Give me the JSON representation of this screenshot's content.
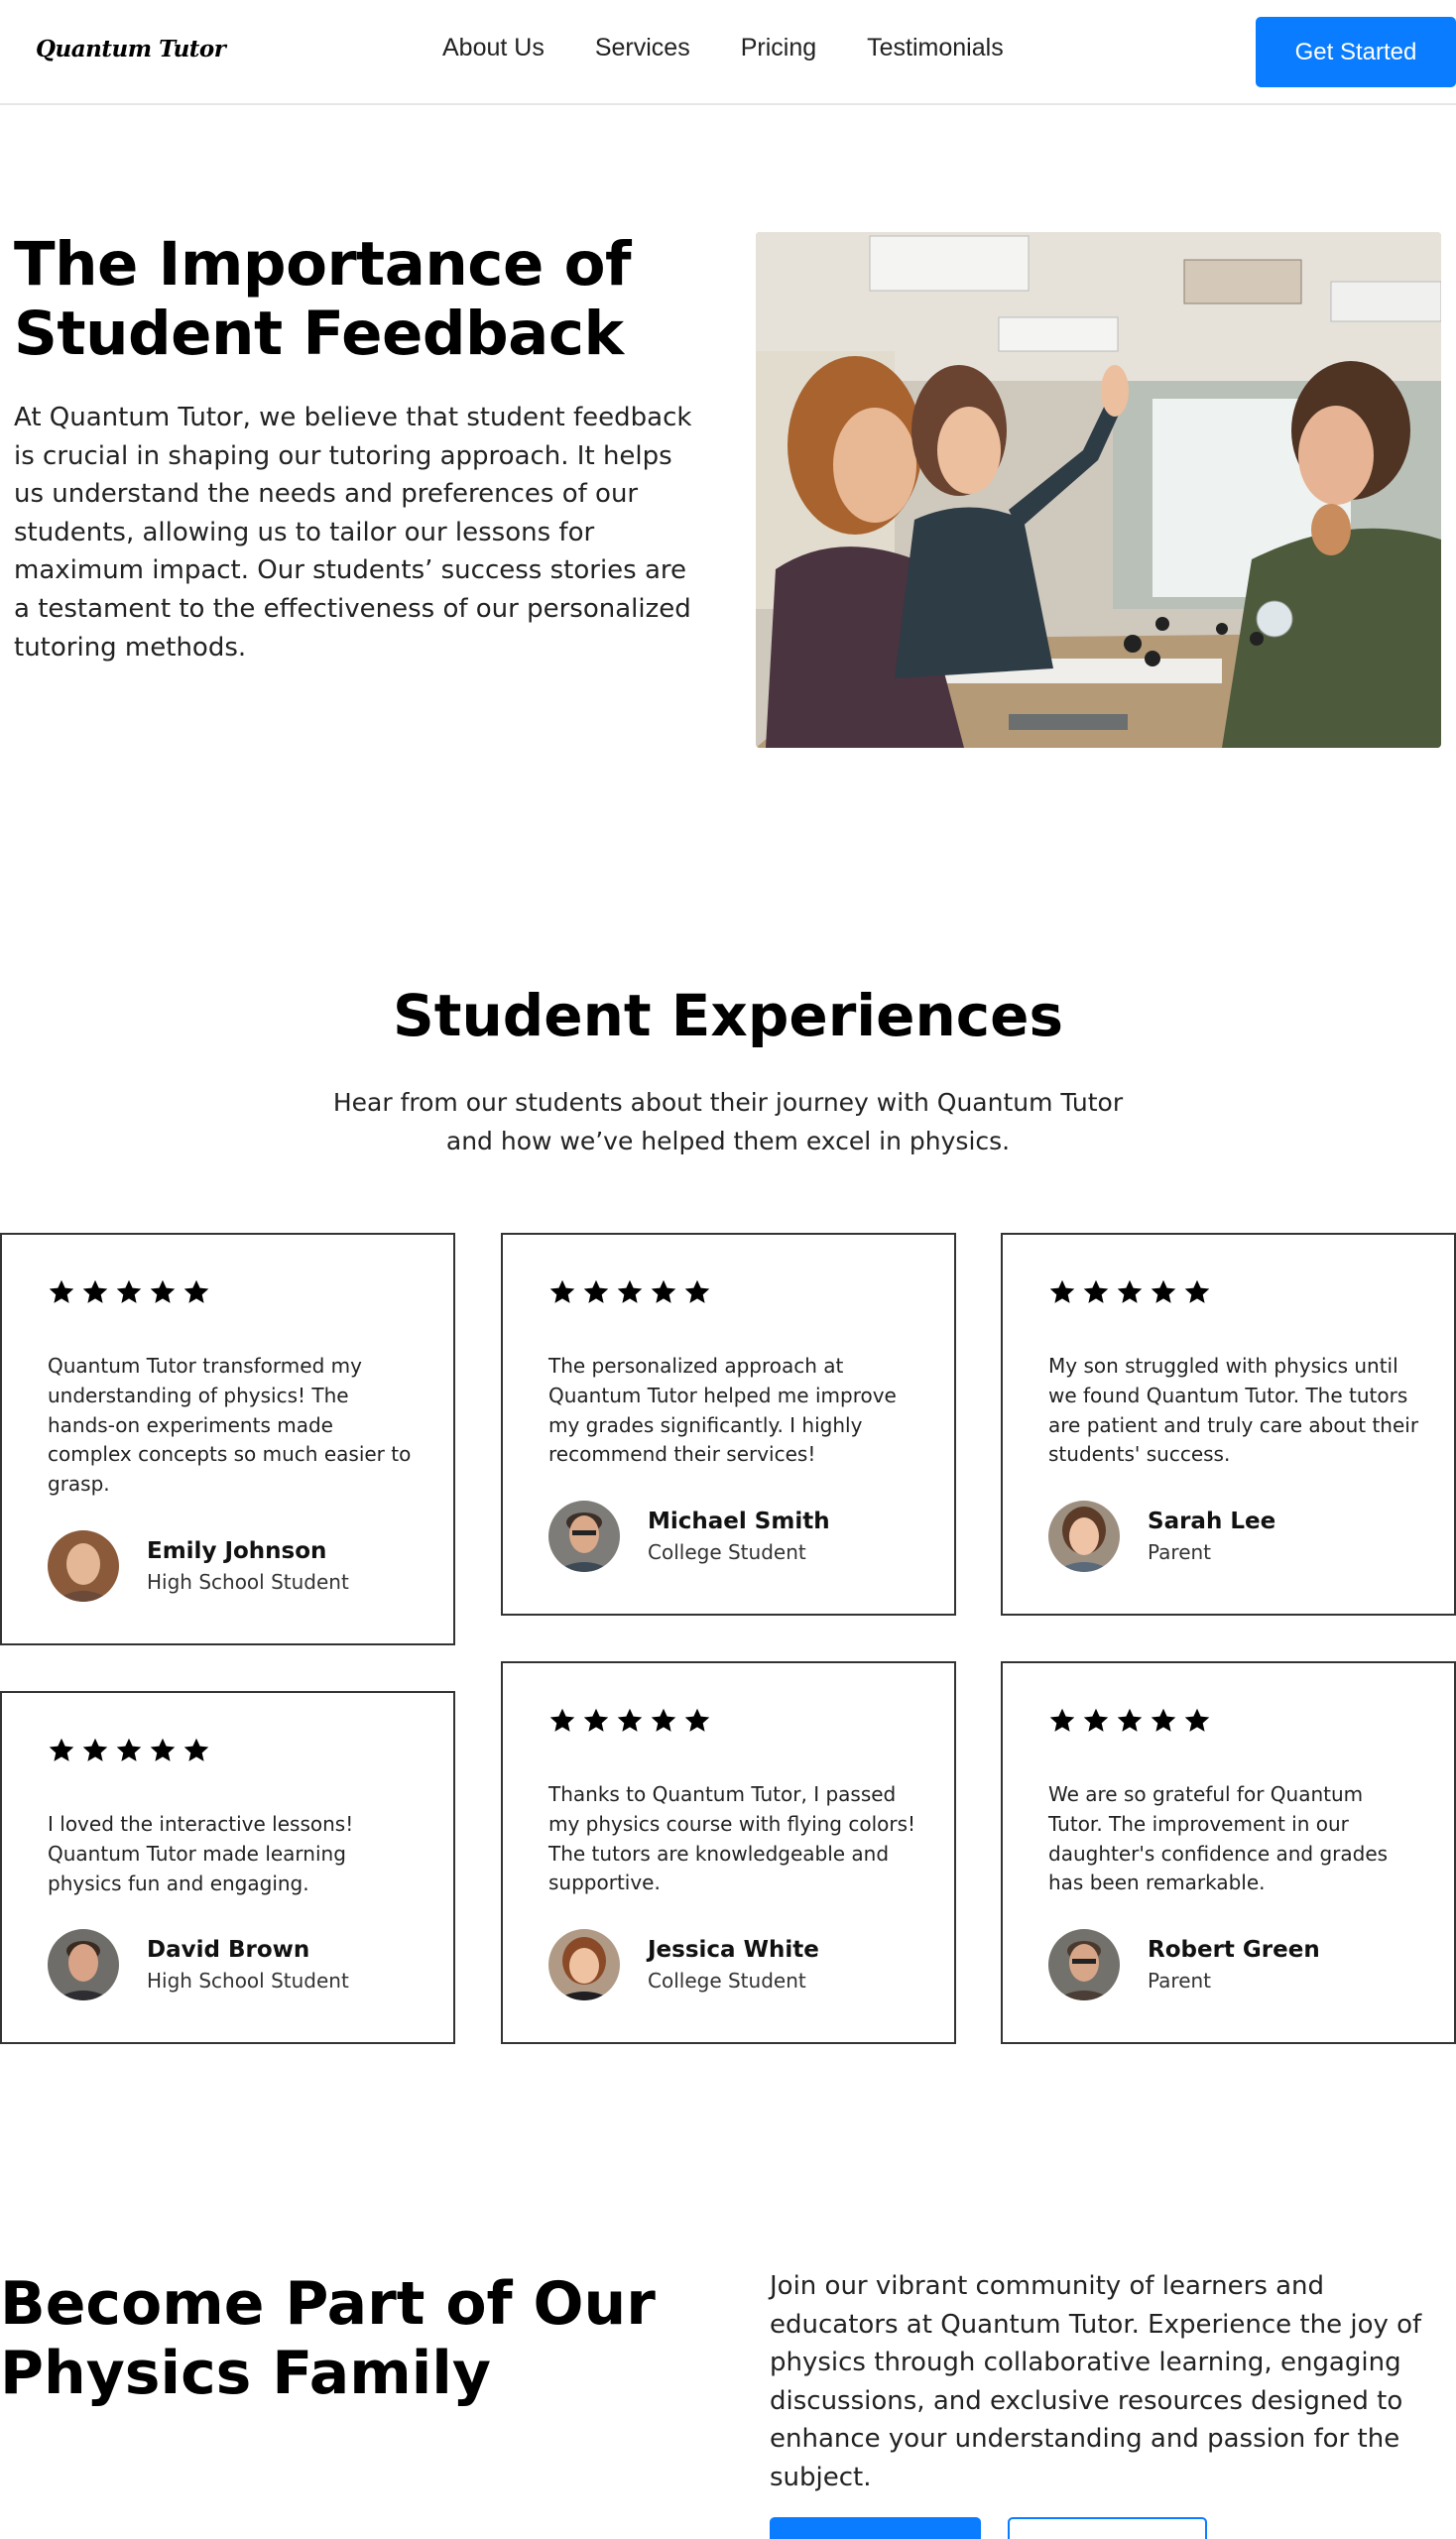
{
  "nav": {
    "logo": "Quantum Tutor",
    "links": [
      "About Us",
      "Services",
      "Pricing",
      "Testimonials"
    ],
    "cta": "Get Started"
  },
  "hero": {
    "title": "The Importance of Student Feedback",
    "text": "At Quantum Tutor, we believe that student feedback is crucial in shaping our tutoring approach. It helps us understand the needs and preferences of our students, allowing us to tailor our lessons for maximum impact. Our students’ success stories are a testament to the effectiveness of our personalized tutoring methods."
  },
  "experiences": {
    "title": "Student Experiences",
    "subtitle": "Hear from our students about their journey with Quantum Tutor and how we’ve helped them excel in physics.",
    "cards": [
      {
        "rating": 5,
        "quote": "Quantum Tutor transformed my understanding of physics! The hands-on experiments made complex concepts so much easier to grasp.",
        "name": "Emily Johnson",
        "role": "High School Student"
      },
      {
        "rating": 5,
        "quote": "The personalized approach at Quantum Tutor helped me improve my grades significantly. I highly recommend their services!",
        "name": "Michael Smith",
        "role": "College Student"
      },
      {
        "rating": 5,
        "quote": "My son struggled with physics until we found Quantum Tutor. The tutors are patient and truly care about their students' success.",
        "name": "Sarah Lee",
        "role": "Parent"
      },
      {
        "rating": 5,
        "quote": "I loved the interactive lessons! Quantum Tutor made learning physics fun and engaging.",
        "name": "David Brown",
        "role": "High School Student"
      },
      {
        "rating": 5,
        "quote": "Thanks to Quantum Tutor, I passed my physics course with flying colors! The tutors are knowledgeable and supportive.",
        "name": "Jessica White",
        "role": "College Student"
      },
      {
        "rating": 5,
        "quote": "We are so grateful for Quantum Tutor. The improvement in our daughter's confidence and grades has been remarkable.",
        "name": "Robert Green",
        "role": "Parent"
      }
    ]
  },
  "join": {
    "title": "Become Part of Our Physics Family",
    "text": "Join our vibrant community of learners and educators at Quantum Tutor. Experience the joy of physics through collaborative learning, engaging discussions, and exclusive resources designed to enhance your understanding and passion for the subject."
  },
  "colors": {
    "accent": "#0a7cff"
  }
}
